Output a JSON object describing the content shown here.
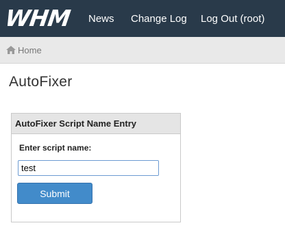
{
  "header": {
    "logo_text": "WHM",
    "nav": {
      "news": "News",
      "change_log": "Change Log",
      "log_out": "Log Out (root)"
    }
  },
  "breadcrumb": {
    "home_icon": "home-icon",
    "home_label": "Home"
  },
  "page": {
    "title": "AutoFixer"
  },
  "form": {
    "panel_title": "AutoFixer Script Name Entry",
    "field_label": "Enter script name:",
    "input_value": "test",
    "submit_label": "Submit"
  },
  "colors": {
    "topbar": "#293a4a",
    "breadcrumb_bg": "#e9e9e9",
    "panel_header_bg": "#e5e5e5",
    "button_bg": "#428bca",
    "input_focus_border": "#6c9bd2"
  }
}
